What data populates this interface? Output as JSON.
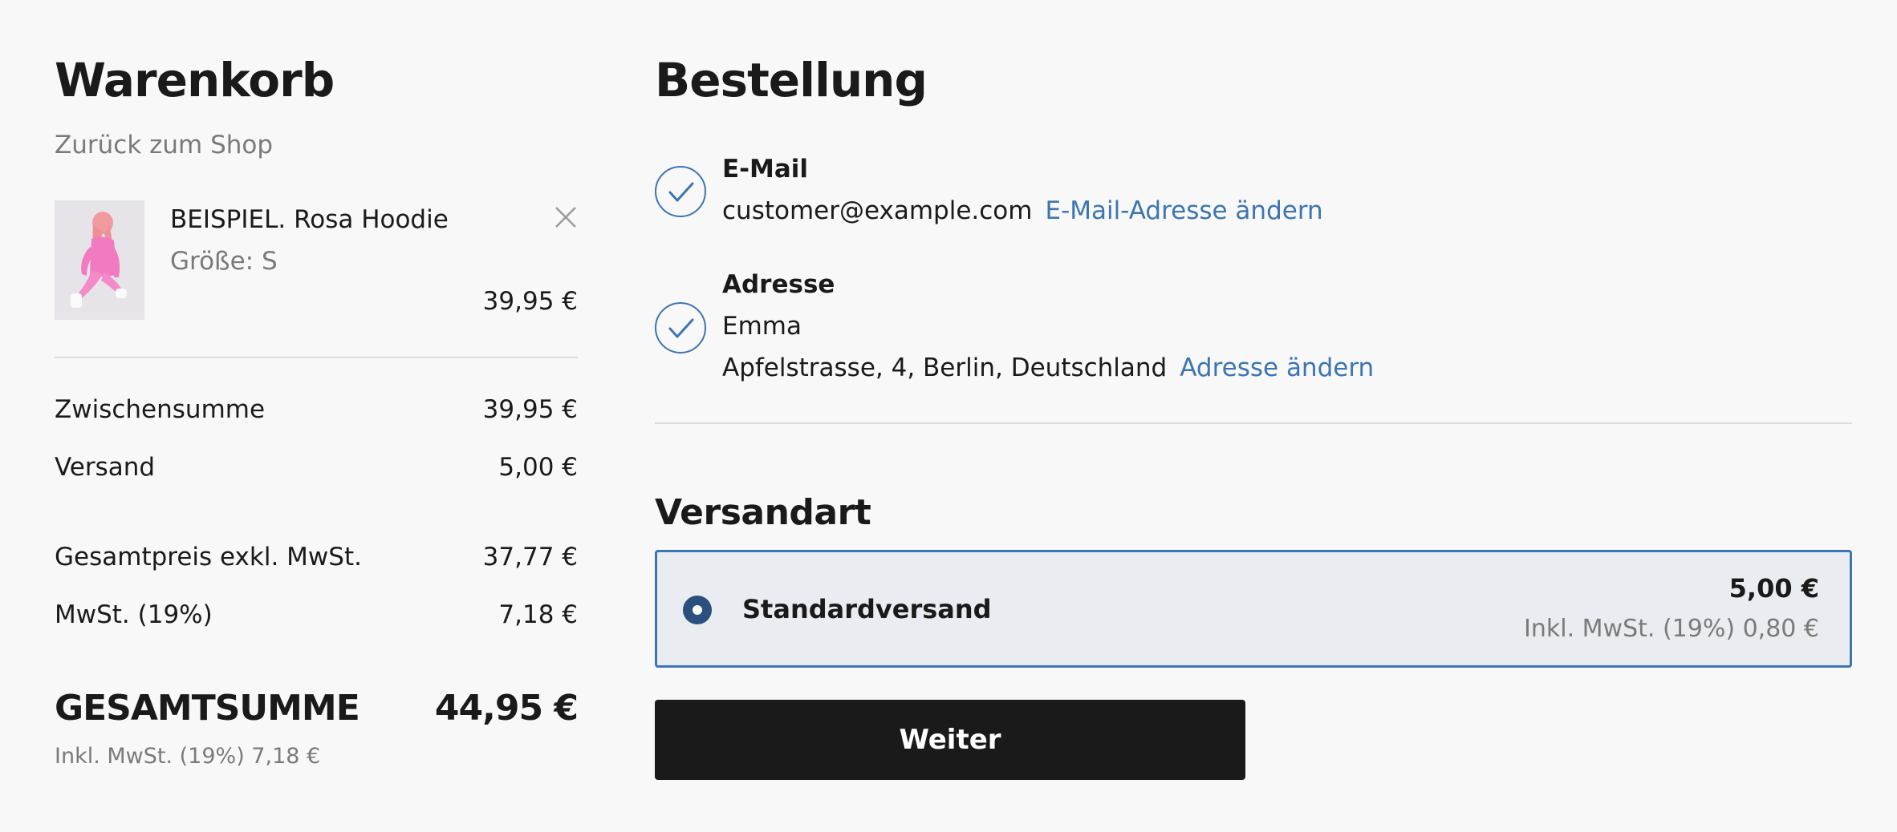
{
  "cart": {
    "title": "Warenkorb",
    "back_link": "Zurück zum Shop",
    "items": [
      {
        "name": "BEISPIEL. Rosa Hoodie",
        "size": "Größe: S",
        "price": "39,95 €",
        "remove_icon": "close-icon"
      }
    ],
    "subtotal": {
      "label": "Zwischensumme",
      "value": "39,95 €"
    },
    "shipping": {
      "label": "Versand",
      "value": "5,00 €"
    },
    "net_total": {
      "label": "Gesamtpreis exkl. MwSt.",
      "value": "37,77 €"
    },
    "vat": {
      "label": "MwSt. (19%)",
      "value": "7,18 €"
    },
    "grand_total": {
      "label": "GESAMTSUMME",
      "value": "44,95 €",
      "note": "Inkl. MwSt. (19%) 7,18 €"
    }
  },
  "order": {
    "title": "Bestellung",
    "email": {
      "label": "E-Mail",
      "value": "customer@example.com",
      "change_link": "E-Mail-Adresse ändern"
    },
    "address": {
      "label": "Adresse",
      "name": "Emma",
      "street": "Apfelstrasse, 4, Berlin, Deutschland",
      "change_link": "Adresse ändern"
    },
    "shipping_method": {
      "title": "Versandart",
      "option_name": "Standardversand",
      "option_price": "5,00 €",
      "option_tax": "Inkl. MwSt. (19%) 0,80 €",
      "selected": true
    },
    "continue_label": "Weiter"
  },
  "colors": {
    "accent": "#3c75b3",
    "radio": "#2b4f7e",
    "button": "#1a1a1a",
    "selected_bg": "#e9edf2",
    "muted_text": "#7a7a7a",
    "background": "#f8f8f8"
  },
  "icons": [
    "close-icon",
    "check-icon",
    "radio-selected-icon"
  ]
}
